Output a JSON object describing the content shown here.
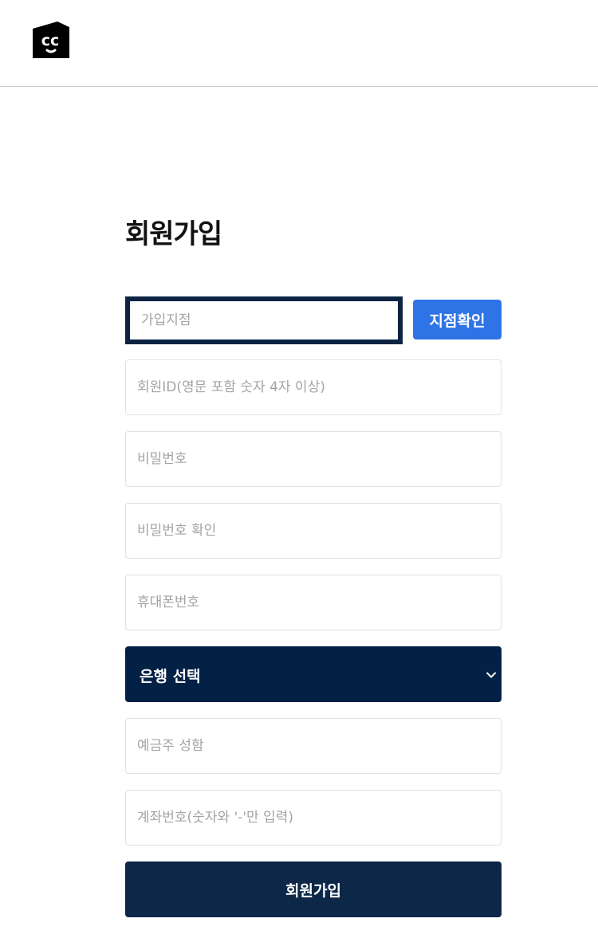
{
  "header": {
    "logo_icon": "cc-logo-icon"
  },
  "form": {
    "title": "회원가입",
    "branch": {
      "placeholder": "가입지점",
      "value": "",
      "button_label": "지점확인"
    },
    "fields": {
      "member_id": {
        "placeholder": "회원ID(영문 포함 숫자 4자 이상)",
        "value": ""
      },
      "password": {
        "placeholder": "비밀번호",
        "value": ""
      },
      "password_confirm": {
        "placeholder": "비밀번호 확인",
        "value": ""
      },
      "phone": {
        "placeholder": "휴대폰번호",
        "value": ""
      },
      "account_holder": {
        "placeholder": "예금주 성함",
        "value": ""
      },
      "account_number": {
        "placeholder": "계좌번호(숫자와 '-'만 입력)",
        "value": ""
      }
    },
    "bank_select": {
      "selected": "은행 선택",
      "icon": "chevron-down-icon"
    },
    "submit_label": "회원가입"
  },
  "colors": {
    "navy": "#032045",
    "navy_button": "#0d2748",
    "branch_border": "#0b2444",
    "blue_button": "#2f74e7",
    "field_border": "#e1e1e1",
    "placeholder": "#a4a4a4",
    "header_border": "#cfcfcf"
  }
}
